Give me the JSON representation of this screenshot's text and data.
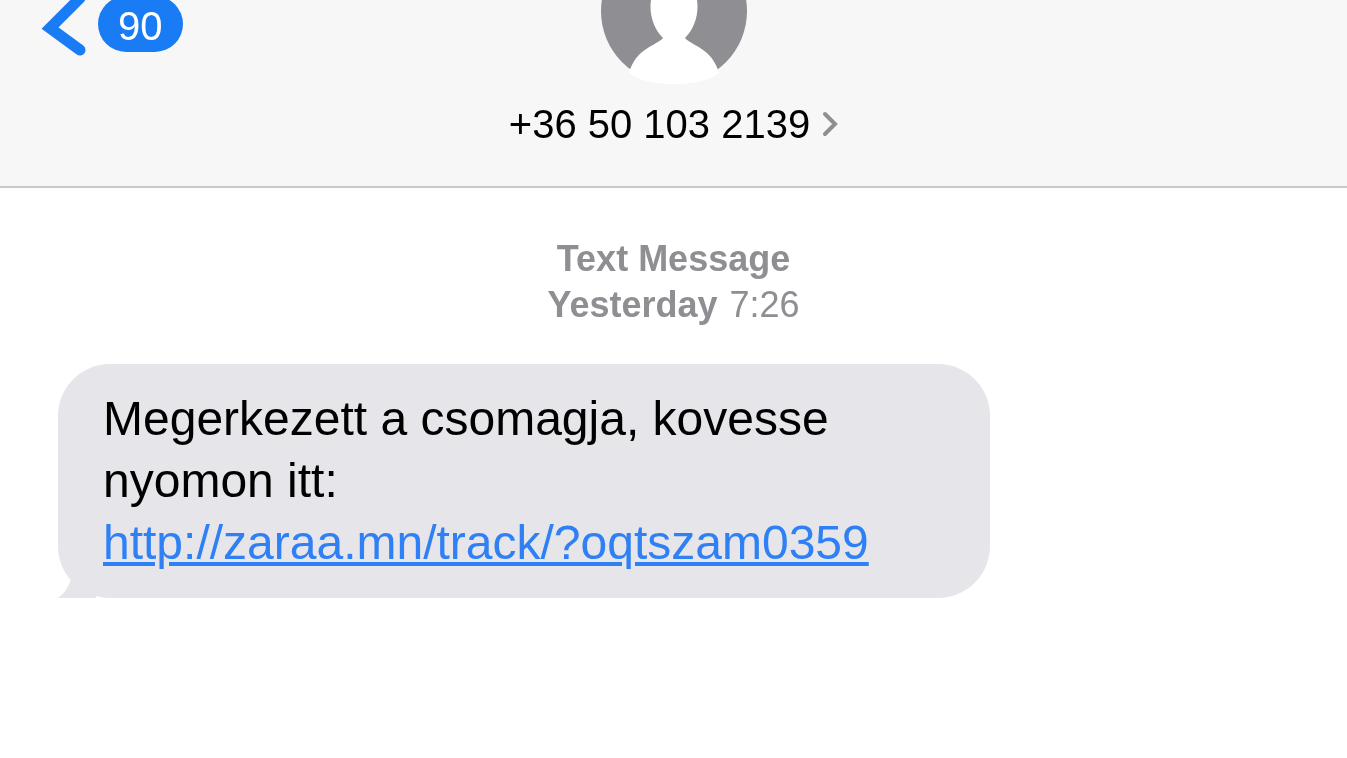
{
  "header": {
    "back_badge": "90",
    "contact": "+36 50 103 2139"
  },
  "conversation": {
    "service": "Text Message",
    "day": "Yesterday",
    "time": "7:26"
  },
  "messages": [
    {
      "kind": "incoming",
      "text": "Megerkezett a csomagja, kovesse nyomon itt:",
      "link": "http://zaraa.mn/track/?oqtszam0359"
    }
  ]
}
